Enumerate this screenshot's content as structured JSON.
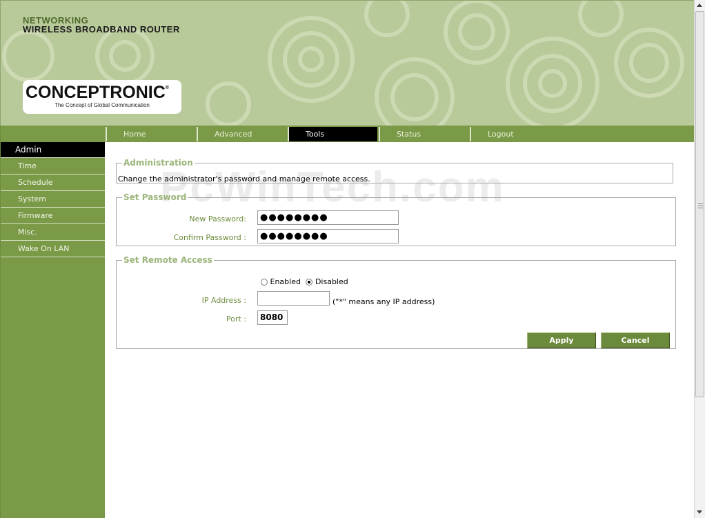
{
  "header": {
    "line1": "NETWORKING",
    "line2": "WIRELESS BROADBAND ROUTER",
    "logo_name": "CONCEPTRONIC",
    "logo_registered": "®",
    "logo_tagline": "The Concept of Global Communication"
  },
  "nav": {
    "tabs": [
      {
        "label": "Home"
      },
      {
        "label": "Advanced"
      },
      {
        "label": "Tools",
        "active": true
      },
      {
        "label": "Status"
      },
      {
        "label": "Logout"
      }
    ]
  },
  "sidebar": {
    "items": [
      {
        "label": "Admin",
        "active": true
      },
      {
        "label": "Time"
      },
      {
        "label": "Schedule"
      },
      {
        "label": "System"
      },
      {
        "label": "Firmware"
      },
      {
        "label": "Misc."
      },
      {
        "label": "Wake On LAN"
      }
    ]
  },
  "administration": {
    "legend": "Administration",
    "description": "Change the administrator's password and manage remote access."
  },
  "set_password": {
    "legend": "Set Password",
    "new_password_label": "New Password:",
    "new_password_value": "●●●●●●●●",
    "confirm_password_label": "Confirm Password :",
    "confirm_password_value": "●●●●●●●●"
  },
  "remote_access": {
    "legend": "Set Remote Access",
    "enabled_label": "Enabled",
    "disabled_label": "Disabled",
    "selected": "Disabled",
    "ip_label": "IP Address :",
    "ip_value": "",
    "ip_hint": "(\"*\" means any IP address)",
    "port_label": "Port :",
    "port_value": "8080"
  },
  "buttons": {
    "apply": "Apply",
    "cancel": "Cancel"
  },
  "watermark": "PcWinTech.com",
  "colors": {
    "header_bg": "#b8c99a",
    "nav_green": "#7b9a48",
    "active_tab": "#000000",
    "legend_green": "#9bb57a"
  }
}
